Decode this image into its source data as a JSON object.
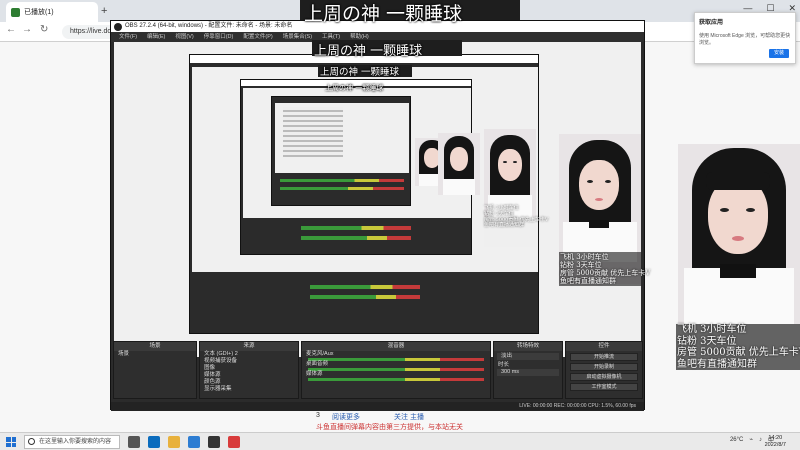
{
  "browser": {
    "tab_title": "已播放(1)",
    "new_tab": "+",
    "address": "https://live.douyu.com/...",
    "nav_back": "←",
    "nav_forward": "→",
    "nav_reload": "↻",
    "win_min": "—",
    "win_max": "☐",
    "win_close": "✕"
  },
  "popup": {
    "title": "获取应用",
    "body": "使用 Microsoft Edge 浏览，可帮助您更快浏览。",
    "button": "安装"
  },
  "page": {
    "number": "3",
    "link_a": "阅读更多",
    "link_b": "关注 主播",
    "notice": "斗鱼直播间弹幕内容由第三方提供，与本站无关",
    "notice2": "请遵守直播规范"
  },
  "obs": {
    "title": "OBS 27.2.4 (64-bit, windows) - 配置文件: 未命名 - 场景: 未命名",
    "menu": [
      "文件(F)",
      "编辑(E)",
      "视图(V)",
      "停靠窗口(D)",
      "配置文件(P)",
      "场景集合(S)",
      "工具(T)",
      "帮助(H)"
    ],
    "docks": {
      "scenes": "场景",
      "sources": "来源",
      "mixer": "混音器",
      "transitions": "转场特效",
      "controls": "控件"
    },
    "scene_item": "场景",
    "sources": [
      "文本 (GDI+) 2",
      "视频捕获设备",
      "图像",
      "媒体源",
      "颜色源",
      "显示器采集"
    ],
    "mixer_tracks": [
      "麦克风/Aux",
      "桌面音频",
      "媒体源"
    ],
    "transition_name": "淡出",
    "duration_label": "时长",
    "duration_value": "300 ms",
    "control_buttons": [
      "开始推流",
      "开始录制",
      "启动虚拟摄像机",
      "工作室模式",
      "设置",
      "退出"
    ],
    "status": "LIVE: 00:00:00   REC: 00:00:00   CPU: 1.5%, 60.00 fps",
    "no_source": "未选择源"
  },
  "overlay": {
    "headline": "上周の神 一颗睡球",
    "caption_lines": [
      "飞机 3小时车位",
      "钻粉 3天车位",
      "房管 5000贡献 优先上车卡V",
      "鱼吧有直播通知群"
    ]
  },
  "taskbar": {
    "search_placeholder": "在这里输入你要搜索的内容",
    "weather": "26°C",
    "time": "14:20",
    "date": "2022/8/7",
    "lang": "中"
  },
  "colors": {
    "obs_bg": "#2b2b2b",
    "accent": "#1a73e8",
    "meter_green": "#3a9a3a",
    "meter_yellow": "#c8c83a",
    "meter_red": "#c43a3a"
  }
}
